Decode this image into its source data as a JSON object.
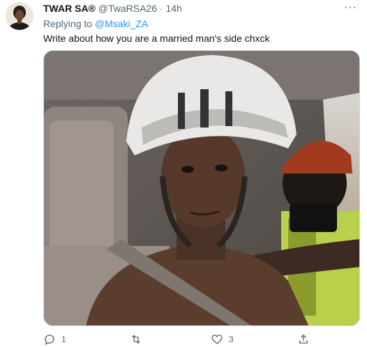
{
  "tweet": {
    "display_name": "TWAR SA®",
    "handle": "@TwaRSA26",
    "separator": "·",
    "age": "14h",
    "reply_prefix": "Replying to",
    "reply_to": "@Msaki_ZA",
    "text": "Write about how you are a married man's side chxck",
    "more_icon": "more-icon",
    "media_type": "photo"
  },
  "actions": {
    "reply_count": "1",
    "retweet_count": "",
    "like_count": "3",
    "share_label": ""
  },
  "colors": {
    "link": "#1d9bf0",
    "secondary_text": "#536471",
    "primary_text": "#0f1419"
  }
}
